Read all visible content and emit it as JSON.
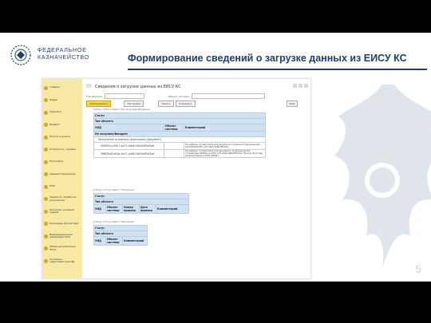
{
  "slide": {
    "logo_line1": "ФЕДЕРАЛЬНОЕ",
    "logo_line2": "КАЗНАЧЕЙСТВО",
    "title": "Формирование сведений о загрузке данных из ЕИСУ КС",
    "page_number": "5"
  },
  "app": {
    "window_title": "Сведения о загрузке данных из ЕИСУ КС",
    "filter_object_label": "Тип объекта:",
    "filter_system_label": "Объект системы:",
    "buttons": [
      "Сформировать",
      "Настройки",
      "Печать",
      "Сохранить",
      "Ещё"
    ],
    "sidebar": [
      "Главное",
      "Кадры",
      "Зарплата",
      "Бюджет",
      "Налоги и взносы",
      "Отчетность, справки",
      "Настройка",
      "Администрирование",
      "НСИ",
      "Задачи по обработке документов",
      "Контроль основных кадров",
      "Календарь бухгалтера",
      "Информационные взаимодействия",
      "Обмен документами ПУОТ",
      "Основные характеристики ИД"
    ],
    "sections": [
      {
        "caption": "Отбор: Статус Равно \"Не загружен/Внедрен\"",
        "headers": [
          "Статус",
          "Тип объекта",
          "УИД",
          "Объект системы",
          "Комментарий"
        ],
        "group": "Не загружен/Внедрен",
        "subgroup": "Назначение основного начисления (Документ)",
        "rows": [
          {
            "uid": "0285f2ca-0907-4a71-a9b6-5d04e9f5d3a6",
            "comment": "Не найдено соответствие для документа. Создание подразделения 1027Ма3Pн0035 ul71 a8e5 9a8bdf5d3a6"
          },
          {
            "uid": "3f983b49-e05a-4e71-a9b6-5d04e9f5d3a6",
            "comment": "Не найдено соответствие для документа. Основные вклад отправление 9DR91e-a-0907-ul71-a8e5-9a8bdf5d3a6. Проход об уставе раздела Перевод 0935-0908а7"
          }
        ]
      },
      {
        "caption": "Отбор: Статус Равно \"Загружен\"",
        "headers": [
          "Статус",
          "Тип объекта",
          "УИД",
          "Объект системы",
          "Номер приказа",
          "Дата приказа",
          "Комментарий"
        ]
      },
      {
        "caption": "Отбор: Статус Равно \"Обновлен\"",
        "headers": [
          "Статус",
          "Тип объекта",
          "УИД",
          "Объект системы",
          "Комментарий"
        ]
      }
    ]
  }
}
